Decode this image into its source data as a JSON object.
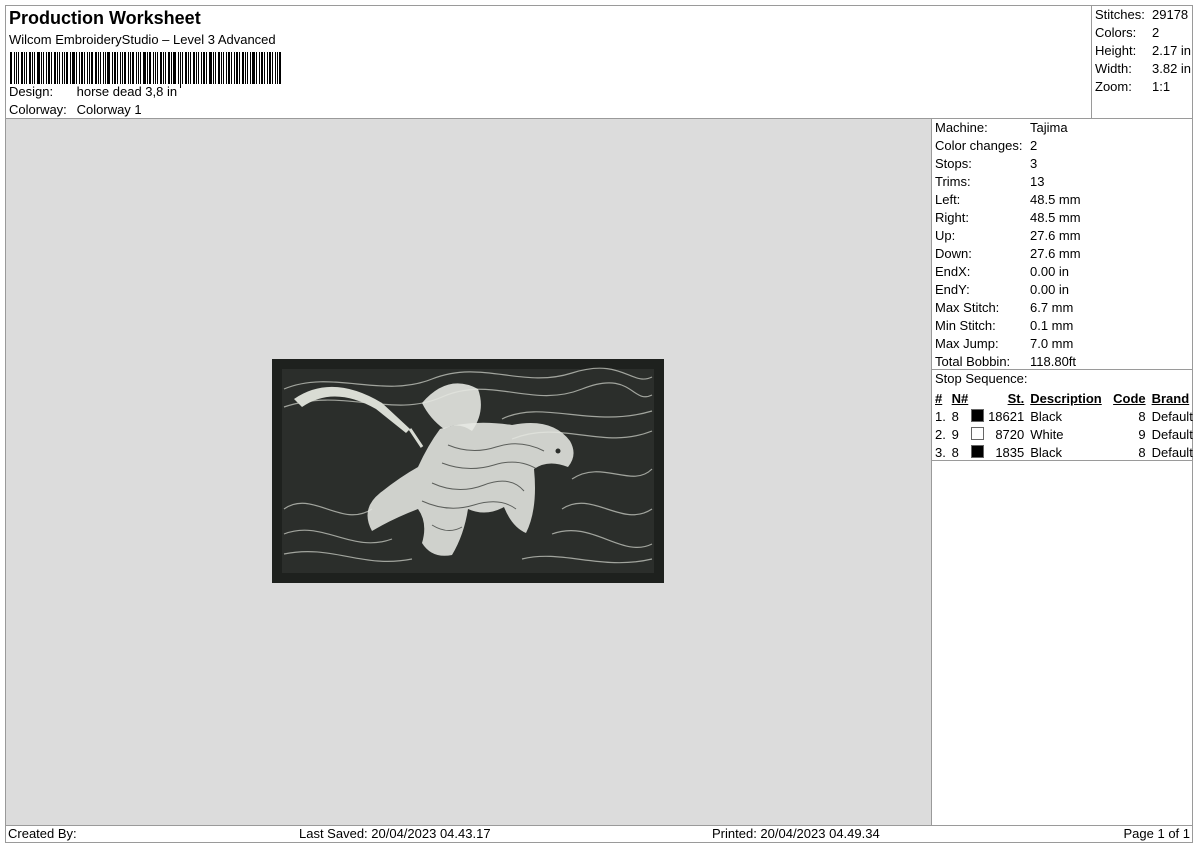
{
  "header": {
    "title": "Production Worksheet",
    "subtitle": "Wilcom EmbroideryStudio – Level 3 Advanced",
    "design_label": "Design:",
    "design_value": "horse dead 3,8 in",
    "colorway_label": "Colorway:",
    "colorway_value": "Colorway 1"
  },
  "summary": [
    {
      "label": "Stitches:",
      "value": "29178"
    },
    {
      "label": "Colors:",
      "value": "2"
    },
    {
      "label": "Height:",
      "value": "2.17 in"
    },
    {
      "label": "Width:",
      "value": "3.82 in"
    },
    {
      "label": "Zoom:",
      "value": "1:1"
    }
  ],
  "machine": [
    {
      "label": "Machine:",
      "value": "Tajima"
    },
    {
      "label": "Color changes:",
      "value": "2"
    },
    {
      "label": "Stops:",
      "value": "3"
    },
    {
      "label": "Trims:",
      "value": "13"
    },
    {
      "label": "Left:",
      "value": "48.5 mm"
    },
    {
      "label": "Right:",
      "value": "48.5 mm"
    },
    {
      "label": "Up:",
      "value": "27.6 mm"
    },
    {
      "label": "Down:",
      "value": "27.6 mm"
    },
    {
      "label": "EndX:",
      "value": "0.00 in"
    },
    {
      "label": "EndY:",
      "value": "0.00 in"
    },
    {
      "label": "Max Stitch:",
      "value": "6.7 mm"
    },
    {
      "label": "Min Stitch:",
      "value": "0.1 mm"
    },
    {
      "label": "Max Jump:",
      "value": "7.0 mm"
    },
    {
      "label": "Total Bobbin:",
      "value": "118.80ft"
    }
  ],
  "stop_sequence": {
    "title": "Stop Sequence:",
    "headers": {
      "num": "#",
      "needle": "N#",
      "stitches": "St.",
      "description": "Description",
      "code": "Code",
      "brand": "Brand"
    },
    "rows": [
      {
        "num": "1.",
        "needle": "8",
        "color": "#000000",
        "stitches": "18621",
        "description": "Black",
        "code": "8",
        "brand": "Default"
      },
      {
        "num": "2.",
        "needle": "9",
        "color": "#ffffff",
        "stitches": "8720",
        "description": "White",
        "code": "9",
        "brand": "Default"
      },
      {
        "num": "3.",
        "needle": "8",
        "color": "#000000",
        "stitches": "1835",
        "description": "Black",
        "code": "8",
        "brand": "Default"
      }
    ]
  },
  "footer": {
    "created_by": "Created By:",
    "last_saved": "Last Saved: 20/04/2023 04.43.17",
    "printed": "Printed: 20/04/2023 04.49.34",
    "page": "Page 1 of 1"
  },
  "colors": {
    "canvas_bg": "#dcdcdc",
    "patch_border": "#1e211e",
    "patch_fill": "#2b2e2b",
    "thread_white": "#e6e8e2"
  }
}
